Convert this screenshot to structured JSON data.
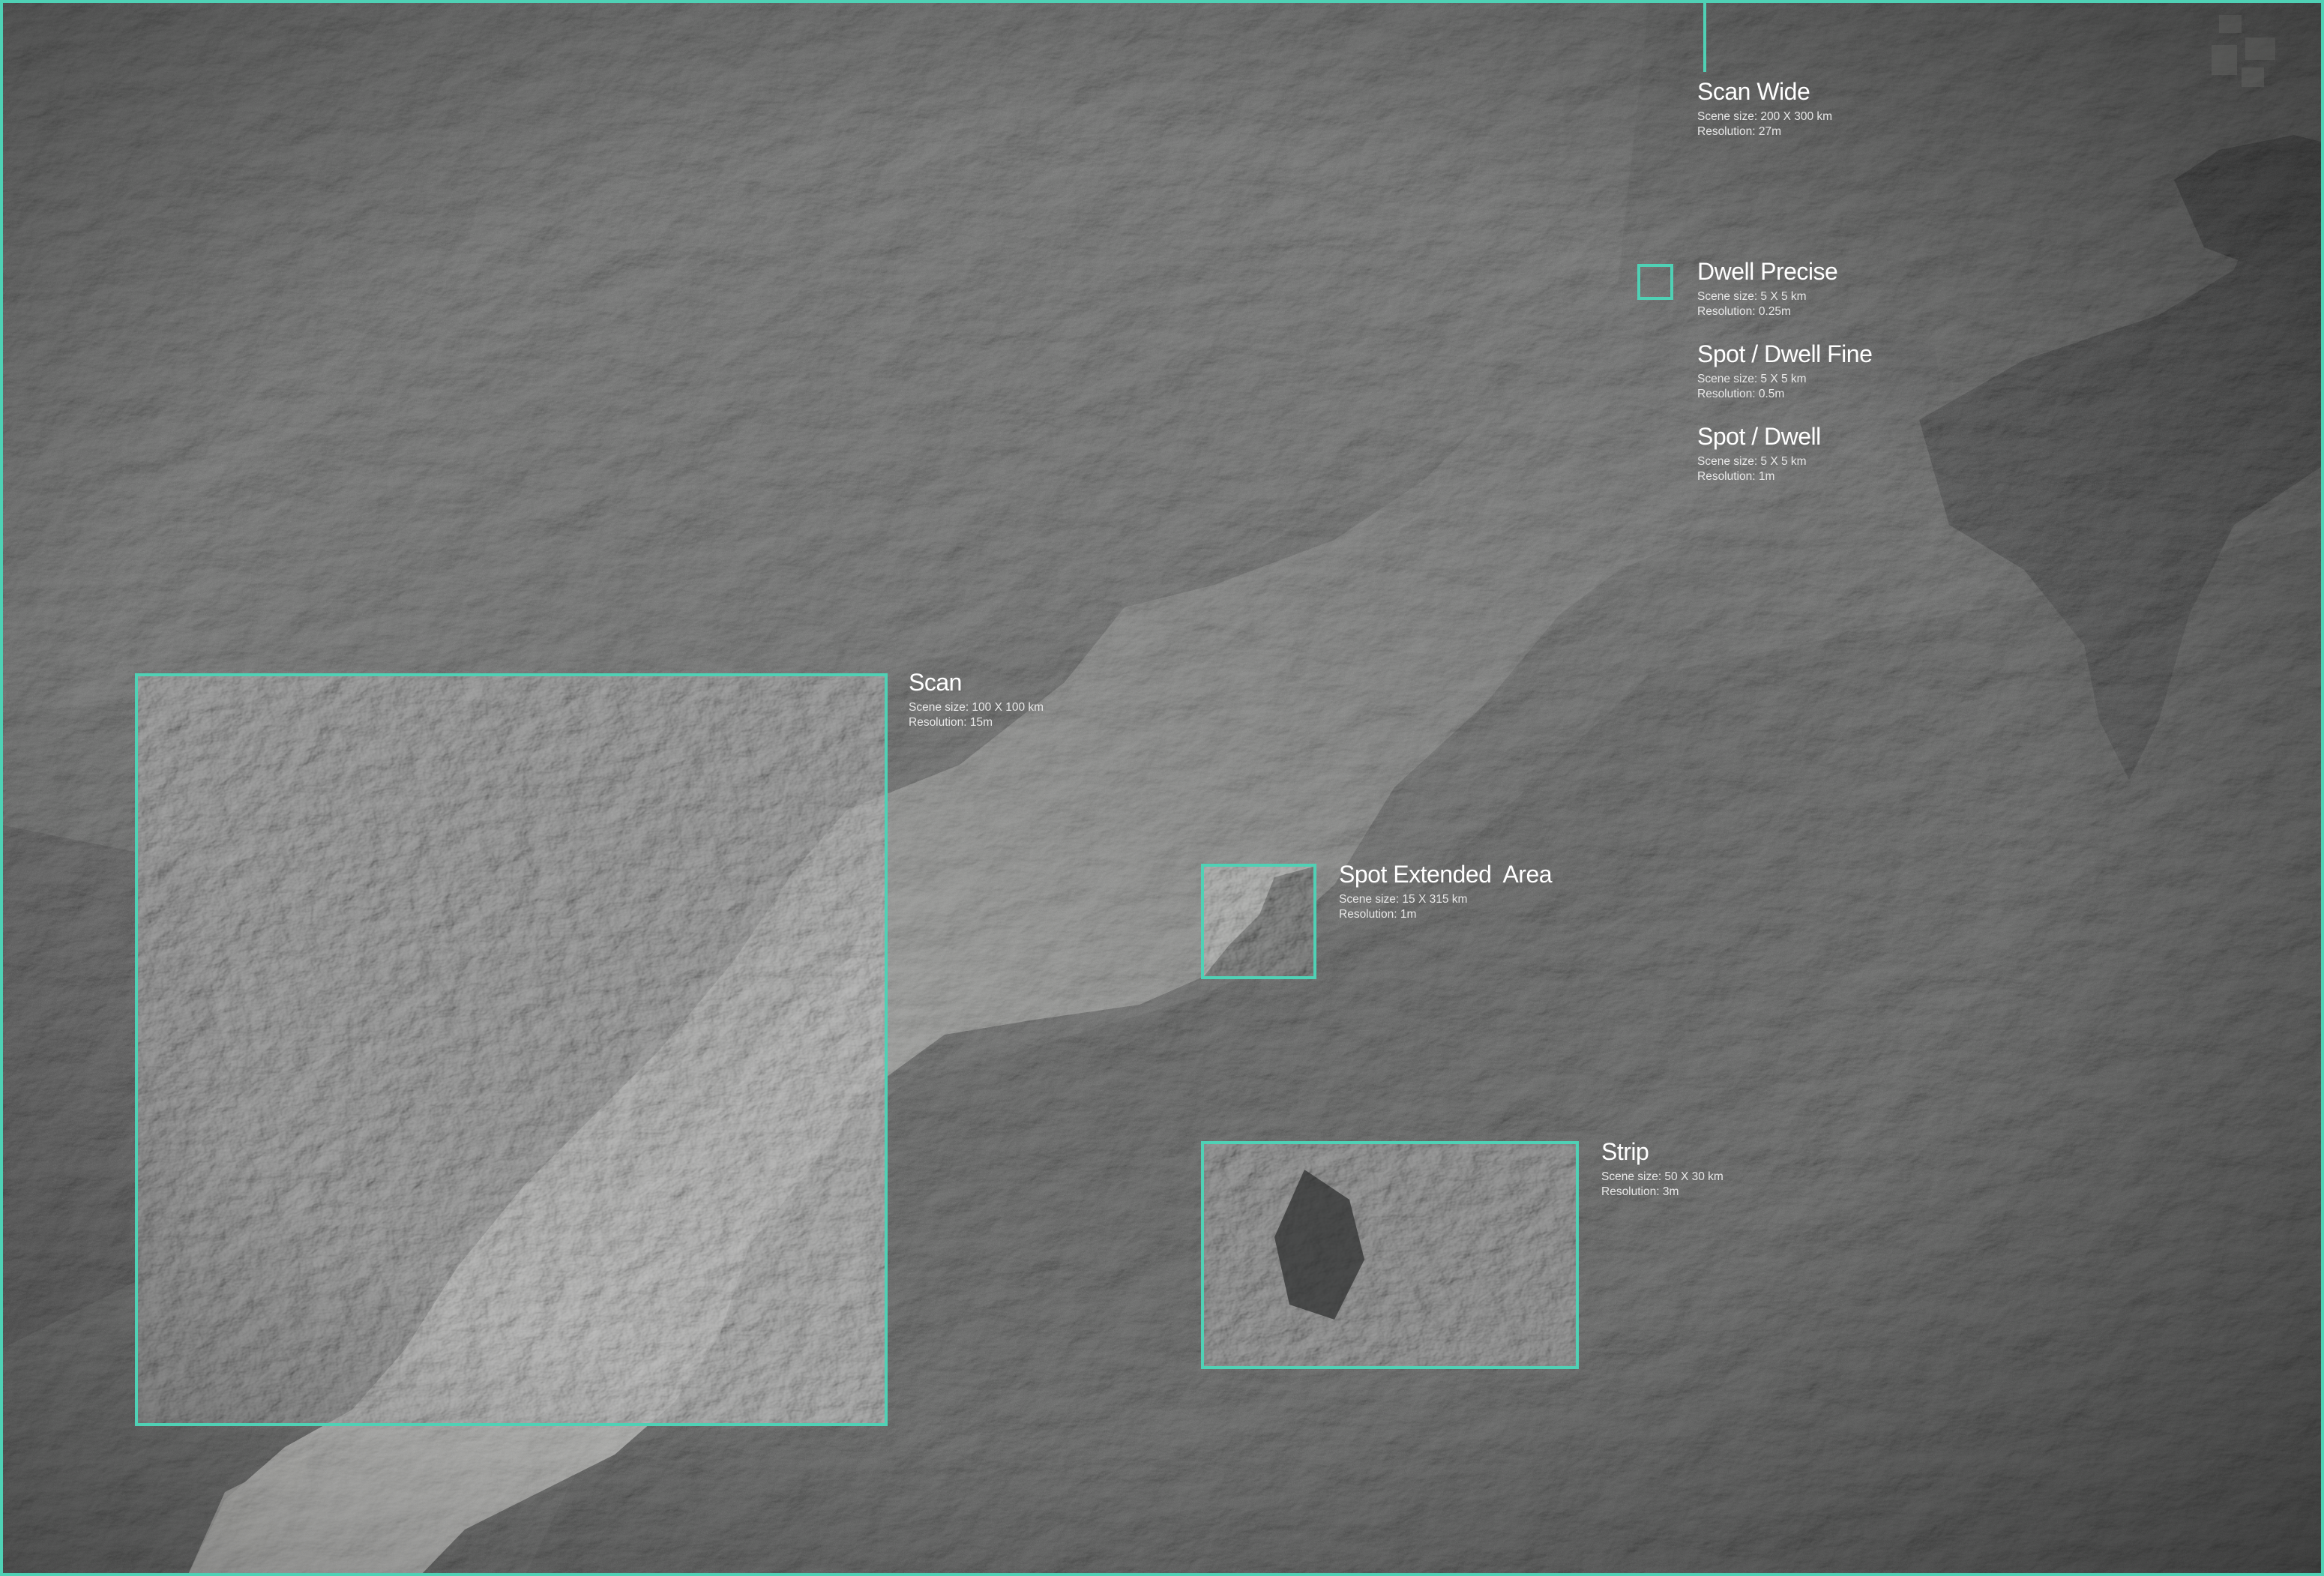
{
  "theme": {
    "accent": "#4fd1b5",
    "land_dark": "#2b2c2c",
    "land_mid": "#4a4b4a",
    "land_light": "#6e6f6d",
    "water": "#6d6e6c",
    "water_bright": "#b9b9b6",
    "label_text": "#ffffff"
  },
  "modes": [
    {
      "id": "scan-wide",
      "title": "Scan Wide",
      "scene_size": "Scene size: 200 X 300 km",
      "resolution": "Resolution: 27m"
    },
    {
      "id": "dwell-precise",
      "title": "Dwell Precise",
      "scene_size": "Scene size: 5 X 5 km",
      "resolution": "Resolution: 0.25m"
    },
    {
      "id": "spot-dwell-fine",
      "title": "Spot / Dwell Fine",
      "scene_size": "Scene size: 5 X 5 km",
      "resolution": "Resolution: 0.5m"
    },
    {
      "id": "spot-dwell",
      "title": "Spot / Dwell",
      "scene_size": "Scene size: 5 X 5 km",
      "resolution": "Resolution: 1m"
    },
    {
      "id": "scan",
      "title": "Scan",
      "scene_size": "Scene size: 100 X 100 km",
      "resolution": "Resolution: 15m"
    },
    {
      "id": "spot-extended-area",
      "title": "Spot Extended  Area",
      "scene_size": "Scene size: 15 X 315 km",
      "resolution": "Resolution: 1m"
    },
    {
      "id": "strip",
      "title": "Strip",
      "scene_size": "Scene size: 50 X 30 km",
      "resolution": "Resolution: 3m"
    }
  ]
}
